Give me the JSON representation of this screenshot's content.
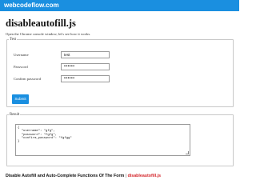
{
  "header": {
    "logo": "webcodeflow.com",
    "background": "#1a8fe0"
  },
  "page": {
    "title": "disableautofill.js",
    "intro": "Open the Chrome console window, let's see how it works."
  },
  "form": {
    "legend": "Test",
    "username_label": "Username",
    "username_value": "test",
    "password_label": "Password",
    "password_value": "••••••",
    "confirm_label": "Confirm password",
    "confirm_value": "••••••",
    "submit_label": "Submit"
  },
  "result": {
    "legend": "Result",
    "output": "{\n  \"username\": \"gfg\",\n  \"password\": \"fgfg\",\n  \"confirm_password\": \"fgfgg\"\n}"
  },
  "footer": {
    "text": "Disable Autofill and Auto-Complete Functions Of The Form",
    "separator": "|",
    "accent_text": "disableautofill.js",
    "accent_color": "#d4262b"
  }
}
